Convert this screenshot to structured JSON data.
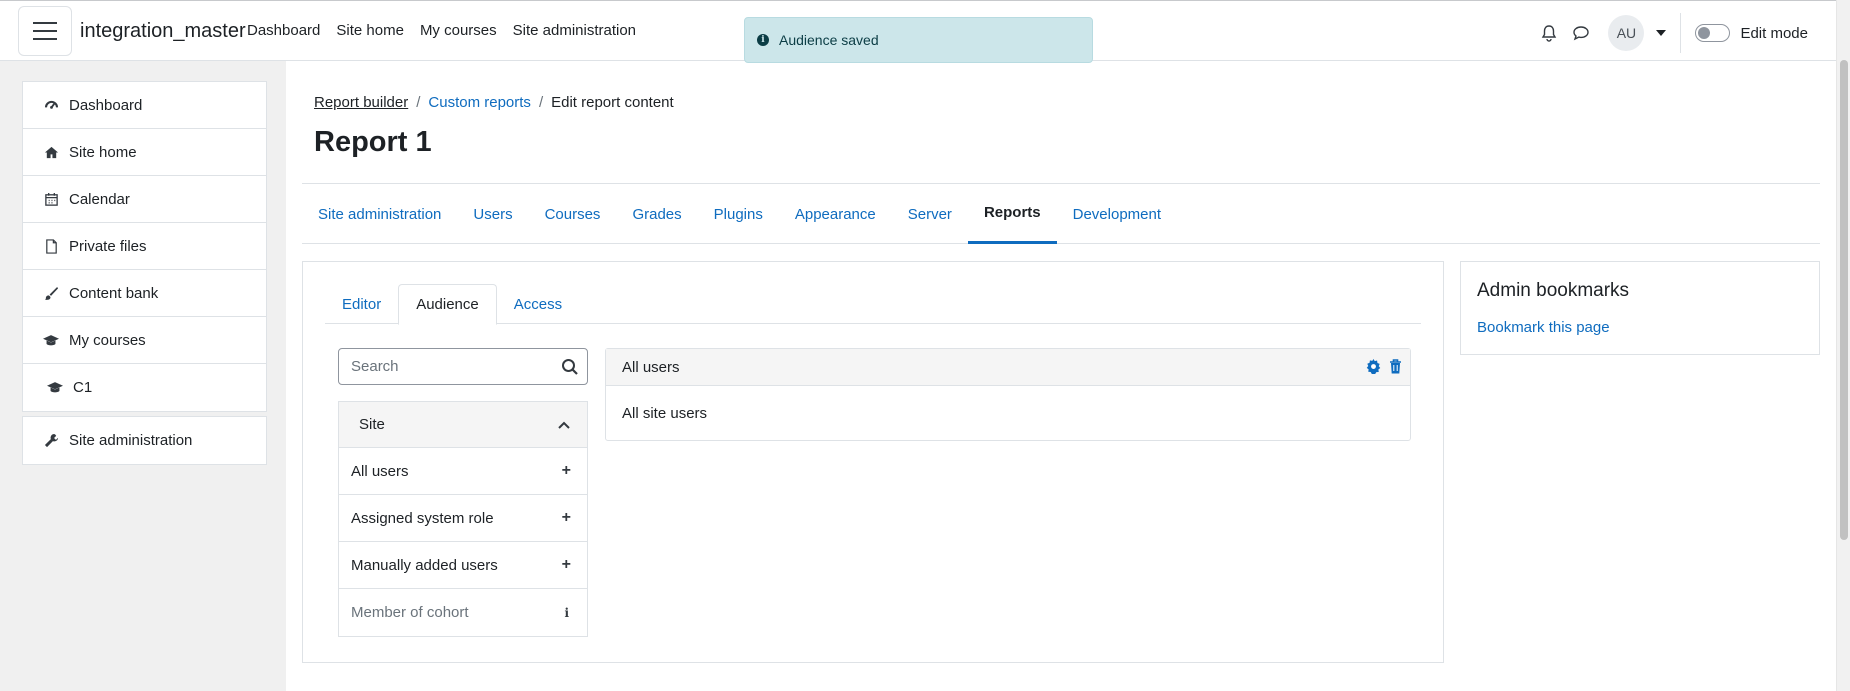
{
  "navbar": {
    "site_name": "integration_master",
    "links": [
      "Dashboard",
      "Site home",
      "My courses",
      "Site administration"
    ],
    "avatar_initials": "AU",
    "edit_mode_label": "Edit mode",
    "edit_mode_on": false
  },
  "toast": {
    "message": "Audience saved"
  },
  "drawer": {
    "items": [
      {
        "label": "Dashboard",
        "icon": "dashboard-icon"
      },
      {
        "label": "Site home",
        "icon": "home-icon"
      },
      {
        "label": "Calendar",
        "icon": "calendar-icon"
      },
      {
        "label": "Private files",
        "icon": "file-icon"
      },
      {
        "label": "Content bank",
        "icon": "brush-icon"
      },
      {
        "label": "My courses",
        "icon": "graduation-cap-icon"
      },
      {
        "label": "C1",
        "icon": "graduation-cap-icon"
      }
    ],
    "admin_item": {
      "label": "Site administration",
      "icon": "wrench-icon"
    }
  },
  "breadcrumb": [
    "Report builder",
    "Custom reports",
    "Edit report content"
  ],
  "page_title": "Report 1",
  "secondary_nav": {
    "tabs": [
      "Site administration",
      "Users",
      "Courses",
      "Grades",
      "Plugins",
      "Appearance",
      "Server",
      "Reports",
      "Development"
    ],
    "active": "Reports"
  },
  "report_tabs": {
    "tabs": [
      "Editor",
      "Audience",
      "Access"
    ],
    "active": "Audience"
  },
  "search": {
    "placeholder": "Search"
  },
  "audience_sidebar": {
    "section": "Site",
    "items": [
      {
        "label": "All users",
        "action": "plus"
      },
      {
        "label": "Assigned system role",
        "action": "plus"
      },
      {
        "label": "Manually added users",
        "action": "plus"
      },
      {
        "label": "Member of cohort",
        "action": "info"
      }
    ]
  },
  "audience_card": {
    "title": "All users",
    "body": "All site users"
  },
  "admin_bookmarks": {
    "title": "Admin bookmarks",
    "link": "Bookmark this page"
  },
  "colors": {
    "link": "#0f6cbf",
    "toast_bg": "#cce6ea",
    "drawer_bg": "#f0f0f0"
  }
}
